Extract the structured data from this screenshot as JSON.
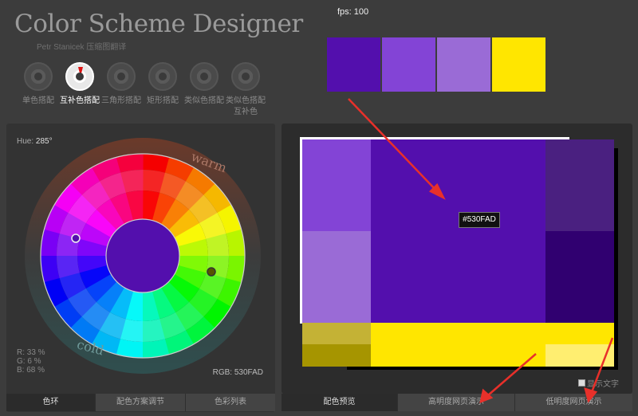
{
  "app": {
    "title": "Color Scheme Designer",
    "subtitle": "Petr Stanicek 压缩图翻译",
    "fps": "fps: 100"
  },
  "modes": [
    {
      "label": "单色搭配",
      "active": false
    },
    {
      "label": "互补色搭配",
      "active": true
    },
    {
      "label": "三角形搭配",
      "active": false
    },
    {
      "label": "矩形搭配",
      "active": false
    },
    {
      "label": "类似色搭配",
      "active": false
    },
    {
      "label": "类似色搭配互补色",
      "active": false
    }
  ],
  "palette": [
    "#530FAD",
    "#8344D6",
    "#9A6BD6",
    "#FFE600"
  ],
  "wheel": {
    "hue_label": "Hue:",
    "hue_value": "285°",
    "warm_label": "warm",
    "cold_label": "cold",
    "rgb": {
      "r": "R: 33 %",
      "g": "G:   6 %",
      "b": "B: 68 %"
    },
    "rgb_hex": "RGB: 530FAD"
  },
  "preview": {
    "tooltip": "#530FAD",
    "colors": {
      "main": "#530FAD",
      "light1": "#8344D6",
      "light2": "#9A6BD6",
      "dark1": "#4A2080",
      "dark2": "#300070",
      "yellow": "#FFE600",
      "yellow_light": "#FFEE70",
      "yellow_dark1": "#C4B235",
      "yellow_dark2": "#A69500"
    },
    "text_toggle": "显示文字"
  },
  "tabs_left": [
    {
      "label": "色环",
      "active": true
    },
    {
      "label": "配色方案调节",
      "active": false
    },
    {
      "label": "色彩列表",
      "active": false
    }
  ],
  "tabs_right": [
    {
      "label": "配色预览",
      "active": true
    },
    {
      "label": "高明度网页演示",
      "active": false
    },
    {
      "label": "低明度网页演示",
      "active": false
    }
  ]
}
